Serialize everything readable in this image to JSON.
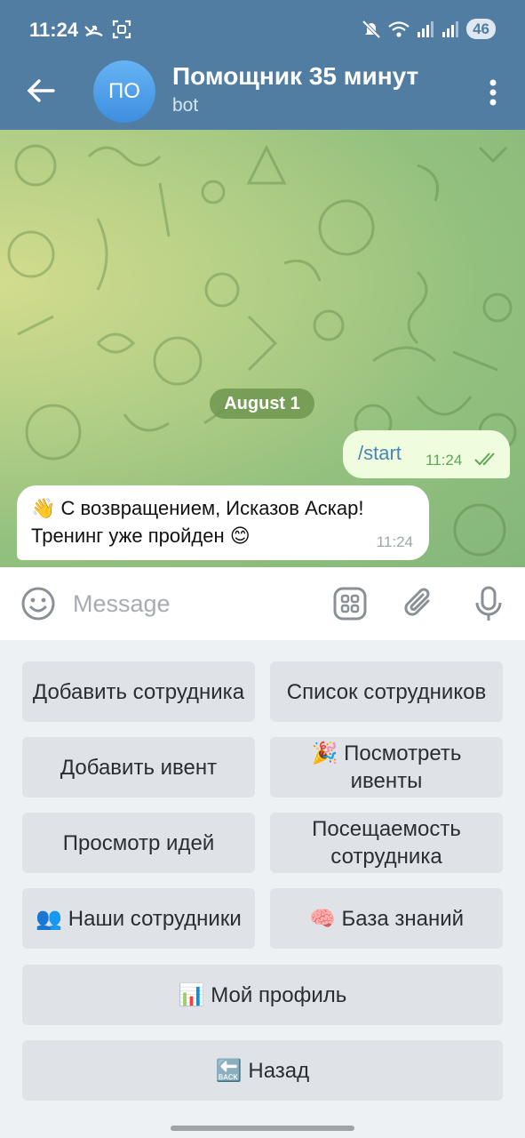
{
  "status_bar": {
    "time": "11:24",
    "battery": "46"
  },
  "header": {
    "avatar_initials": "ПО",
    "title": "Помощник 35 минут",
    "subtitle": "bot"
  },
  "chat": {
    "date_label": "August 1",
    "outgoing": {
      "text": "/start",
      "time": "11:24"
    },
    "incoming": {
      "line1": "👋 С возвращением, Исказов Аскар!",
      "line2": "Тренинг уже пройден 😊",
      "time": "11:24"
    }
  },
  "input": {
    "placeholder": "Message"
  },
  "keyboard": {
    "add_employee": "Добавить сотрудника",
    "employee_list": "Список сотрудников",
    "add_event": "Добавить ивент",
    "view_events": "🎉 Посмотреть ивенты",
    "view_ideas": "Просмотр идей",
    "attendance": "Посещаемость сотрудника",
    "our_employees": "👥 Наши сотрудники",
    "knowledge_base": "🧠 База знаний",
    "my_profile": "📊 Мой профиль",
    "back": "🔙 Назад"
  }
}
